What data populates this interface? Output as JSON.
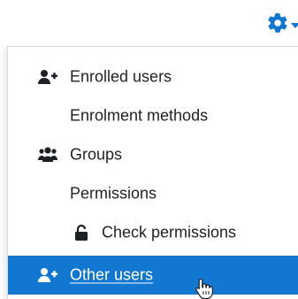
{
  "menu": {
    "items": [
      {
        "label": "Enrolled users",
        "icon": "user-plus-icon"
      },
      {
        "label": "Enrolment methods",
        "icon": ""
      },
      {
        "label": "Groups",
        "icon": "users-icon"
      },
      {
        "label": "Permissions",
        "icon": ""
      },
      {
        "label": "Check permissions",
        "icon": "unlock-icon"
      },
      {
        "label": "Other users",
        "icon": "user-plus-icon",
        "state": "hovered"
      }
    ]
  },
  "header": {
    "icon": "gear-icon"
  },
  "colors": {
    "accent": "#1177d1",
    "text": "#1d2125",
    "active_text": "#ffffff"
  }
}
